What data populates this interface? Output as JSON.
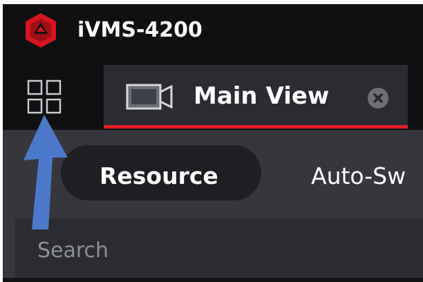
{
  "app": {
    "title": "iVMS-4200"
  },
  "tabs": [
    {
      "label": "Main View",
      "active": true
    }
  ],
  "panel": {
    "segments": [
      {
        "label": "Resource",
        "active": true
      },
      {
        "label": "Auto-Sw"
      }
    ],
    "search": {
      "placeholder": "Search",
      "value": ""
    }
  },
  "icons": {
    "logo": "ivms-logo-icon",
    "grid": "grid-menu-icon",
    "camera": "camera-icon",
    "close": "close-icon",
    "arrow": "blue-arrow-annotation"
  },
  "colors": {
    "accent": "#e31b23",
    "titlebar": "#0f1012",
    "tab_bg": "#2a2c31",
    "content_bg": "#35373d",
    "pill_bg": "#1e1f23",
    "arrow": "#4a7ac9"
  }
}
